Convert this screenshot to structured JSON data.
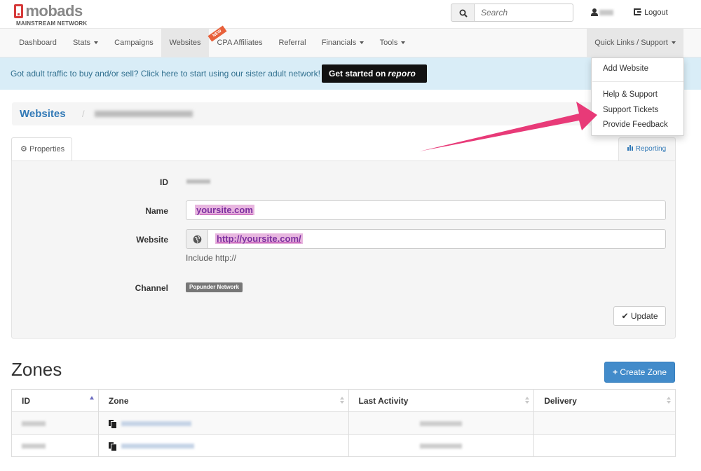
{
  "brand": {
    "name": "mobads",
    "tagline": "MAINSTREAM NETWORK"
  },
  "header": {
    "search_placeholder": "Search",
    "logout_label": "Logout"
  },
  "nav": {
    "items": [
      {
        "label": "Dashboard"
      },
      {
        "label": "Stats"
      },
      {
        "label": "Campaigns"
      },
      {
        "label": "Websites"
      },
      {
        "label": "CPA Affiliates"
      },
      {
        "label": "Referral"
      },
      {
        "label": "Financials"
      },
      {
        "label": "Tools"
      }
    ],
    "active": "Websites",
    "new_badge": "NEW",
    "quick_links_label": "Quick Links / Support"
  },
  "alert": {
    "text": "Got adult traffic to buy and/or sell? Click here to start using our sister adult network!",
    "button_prefix": "Get started on",
    "button_brand": "reporo"
  },
  "breadcrumb": {
    "parent": "Websites",
    "separator": "/"
  },
  "tabs": {
    "properties": "Properties",
    "reporting": "Reporting"
  },
  "form": {
    "id_label": "ID",
    "name_label": "Name",
    "name_value": "yoursite.com",
    "website_label": "Website",
    "website_value": "http://yoursite.com/",
    "website_help": "Include http://",
    "channel_label": "Channel",
    "channel_value": "Popunder Network",
    "update_label": "Update"
  },
  "zones": {
    "title": "Zones",
    "create_label": "Create Zone",
    "columns": [
      "ID",
      "Zone",
      "Last Activity",
      "Delivery"
    ]
  },
  "dropdown": {
    "items": [
      "Add Website",
      "Help & Support",
      "Support Tickets",
      "Provide Feedback"
    ]
  },
  "colors": {
    "primary": "#428bca",
    "link": "#337ab7",
    "alert_bg": "#d9edf7",
    "arrow": "#e83a78",
    "brand_red": "#d63a3a"
  }
}
